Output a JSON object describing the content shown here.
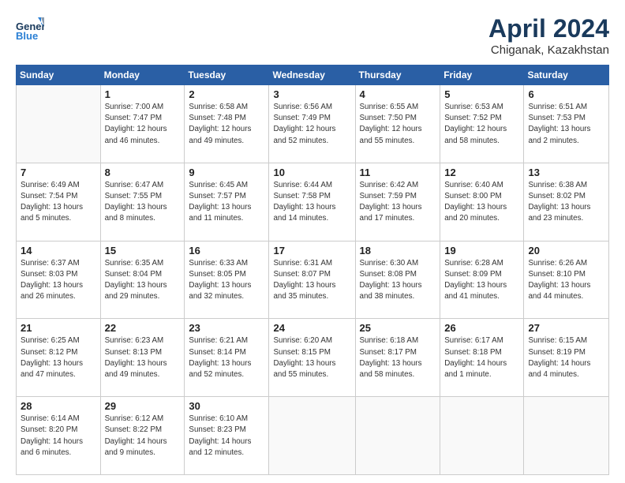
{
  "header": {
    "logo_line1": "General",
    "logo_line2": "Blue",
    "month": "April 2024",
    "location": "Chiganak, Kazakhstan"
  },
  "weekdays": [
    "Sunday",
    "Monday",
    "Tuesday",
    "Wednesday",
    "Thursday",
    "Friday",
    "Saturday"
  ],
  "weeks": [
    [
      {
        "day": "",
        "info": ""
      },
      {
        "day": "1",
        "info": "Sunrise: 7:00 AM\nSunset: 7:47 PM\nDaylight: 12 hours\nand 46 minutes."
      },
      {
        "day": "2",
        "info": "Sunrise: 6:58 AM\nSunset: 7:48 PM\nDaylight: 12 hours\nand 49 minutes."
      },
      {
        "day": "3",
        "info": "Sunrise: 6:56 AM\nSunset: 7:49 PM\nDaylight: 12 hours\nand 52 minutes."
      },
      {
        "day": "4",
        "info": "Sunrise: 6:55 AM\nSunset: 7:50 PM\nDaylight: 12 hours\nand 55 minutes."
      },
      {
        "day": "5",
        "info": "Sunrise: 6:53 AM\nSunset: 7:52 PM\nDaylight: 12 hours\nand 58 minutes."
      },
      {
        "day": "6",
        "info": "Sunrise: 6:51 AM\nSunset: 7:53 PM\nDaylight: 13 hours\nand 2 minutes."
      }
    ],
    [
      {
        "day": "7",
        "info": "Sunrise: 6:49 AM\nSunset: 7:54 PM\nDaylight: 13 hours\nand 5 minutes."
      },
      {
        "day": "8",
        "info": "Sunrise: 6:47 AM\nSunset: 7:55 PM\nDaylight: 13 hours\nand 8 minutes."
      },
      {
        "day": "9",
        "info": "Sunrise: 6:45 AM\nSunset: 7:57 PM\nDaylight: 13 hours\nand 11 minutes."
      },
      {
        "day": "10",
        "info": "Sunrise: 6:44 AM\nSunset: 7:58 PM\nDaylight: 13 hours\nand 14 minutes."
      },
      {
        "day": "11",
        "info": "Sunrise: 6:42 AM\nSunset: 7:59 PM\nDaylight: 13 hours\nand 17 minutes."
      },
      {
        "day": "12",
        "info": "Sunrise: 6:40 AM\nSunset: 8:00 PM\nDaylight: 13 hours\nand 20 minutes."
      },
      {
        "day": "13",
        "info": "Sunrise: 6:38 AM\nSunset: 8:02 PM\nDaylight: 13 hours\nand 23 minutes."
      }
    ],
    [
      {
        "day": "14",
        "info": "Sunrise: 6:37 AM\nSunset: 8:03 PM\nDaylight: 13 hours\nand 26 minutes."
      },
      {
        "day": "15",
        "info": "Sunrise: 6:35 AM\nSunset: 8:04 PM\nDaylight: 13 hours\nand 29 minutes."
      },
      {
        "day": "16",
        "info": "Sunrise: 6:33 AM\nSunset: 8:05 PM\nDaylight: 13 hours\nand 32 minutes."
      },
      {
        "day": "17",
        "info": "Sunrise: 6:31 AM\nSunset: 8:07 PM\nDaylight: 13 hours\nand 35 minutes."
      },
      {
        "day": "18",
        "info": "Sunrise: 6:30 AM\nSunset: 8:08 PM\nDaylight: 13 hours\nand 38 minutes."
      },
      {
        "day": "19",
        "info": "Sunrise: 6:28 AM\nSunset: 8:09 PM\nDaylight: 13 hours\nand 41 minutes."
      },
      {
        "day": "20",
        "info": "Sunrise: 6:26 AM\nSunset: 8:10 PM\nDaylight: 13 hours\nand 44 minutes."
      }
    ],
    [
      {
        "day": "21",
        "info": "Sunrise: 6:25 AM\nSunset: 8:12 PM\nDaylight: 13 hours\nand 47 minutes."
      },
      {
        "day": "22",
        "info": "Sunrise: 6:23 AM\nSunset: 8:13 PM\nDaylight: 13 hours\nand 49 minutes."
      },
      {
        "day": "23",
        "info": "Sunrise: 6:21 AM\nSunset: 8:14 PM\nDaylight: 13 hours\nand 52 minutes."
      },
      {
        "day": "24",
        "info": "Sunrise: 6:20 AM\nSunset: 8:15 PM\nDaylight: 13 hours\nand 55 minutes."
      },
      {
        "day": "25",
        "info": "Sunrise: 6:18 AM\nSunset: 8:17 PM\nDaylight: 13 hours\nand 58 minutes."
      },
      {
        "day": "26",
        "info": "Sunrise: 6:17 AM\nSunset: 8:18 PM\nDaylight: 14 hours\nand 1 minute."
      },
      {
        "day": "27",
        "info": "Sunrise: 6:15 AM\nSunset: 8:19 PM\nDaylight: 14 hours\nand 4 minutes."
      }
    ],
    [
      {
        "day": "28",
        "info": "Sunrise: 6:14 AM\nSunset: 8:20 PM\nDaylight: 14 hours\nand 6 minutes."
      },
      {
        "day": "29",
        "info": "Sunrise: 6:12 AM\nSunset: 8:22 PM\nDaylight: 14 hours\nand 9 minutes."
      },
      {
        "day": "30",
        "info": "Sunrise: 6:10 AM\nSunset: 8:23 PM\nDaylight: 14 hours\nand 12 minutes."
      },
      {
        "day": "",
        "info": ""
      },
      {
        "day": "",
        "info": ""
      },
      {
        "day": "",
        "info": ""
      },
      {
        "day": "",
        "info": ""
      }
    ]
  ]
}
